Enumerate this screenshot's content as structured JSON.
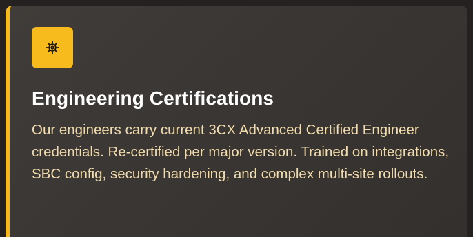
{
  "card": {
    "title": "Engineering Certifications",
    "description": "Our engineers carry current 3CX Advanced Certified Engineer credentials. Re-certified per major version. Trained on integrations, SBC config, security hardening, and complex multi-site rollouts.",
    "icon": "gear-icon",
    "accent_color": "#f5b91e",
    "text_color": "#f2dcab"
  }
}
